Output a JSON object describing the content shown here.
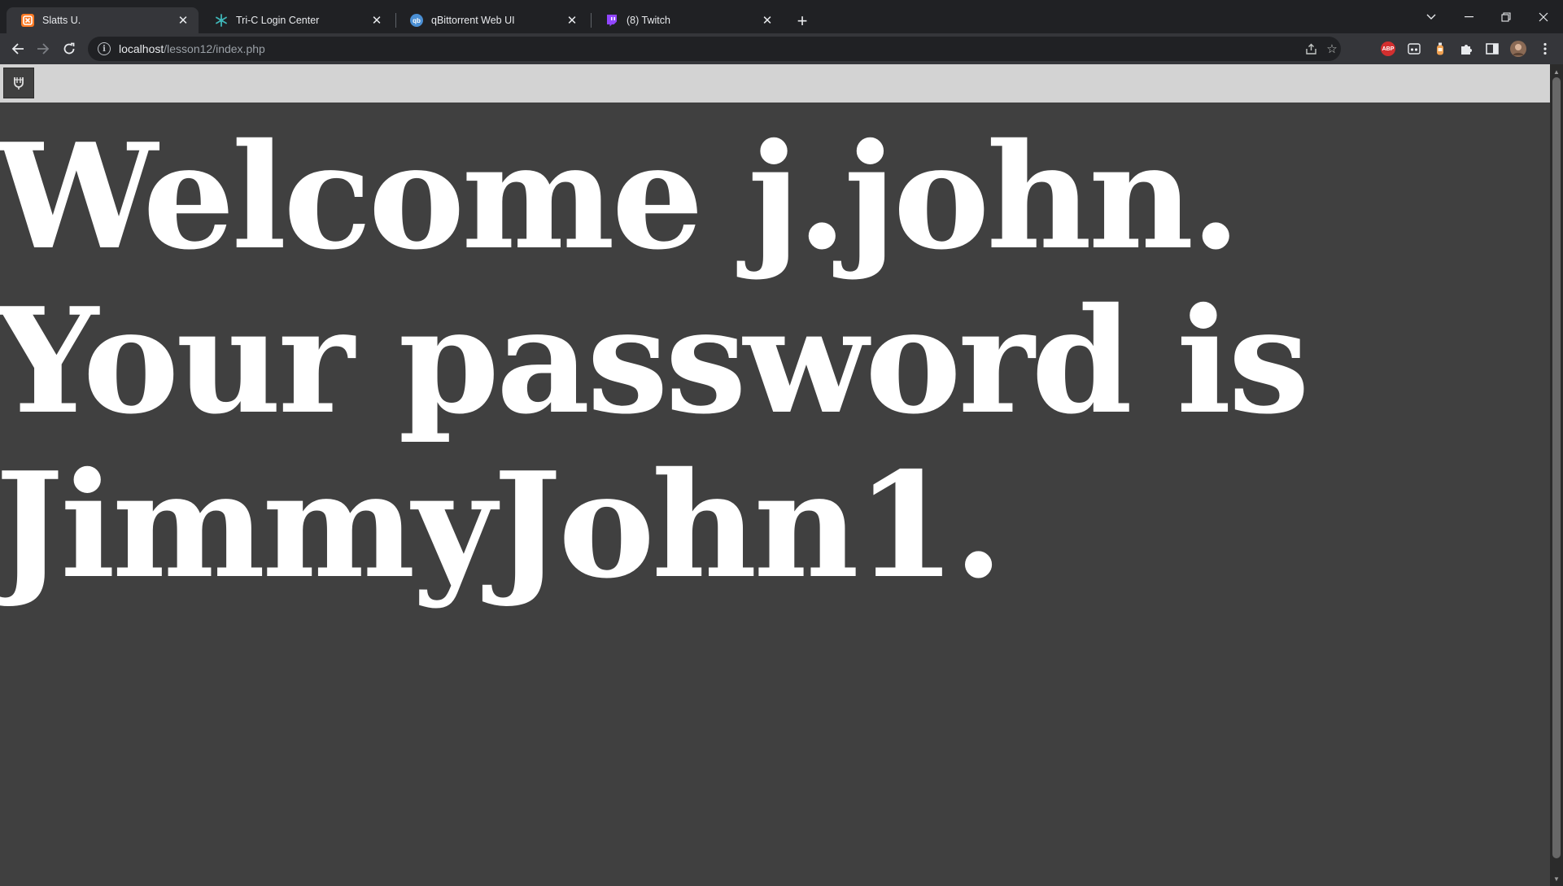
{
  "browser": {
    "tabs": [
      {
        "title": "Slatts U.",
        "favicon": "xampp-icon",
        "favicon_color": "#fb7a24",
        "active": true
      },
      {
        "title": "Tri-C Login Center",
        "favicon": "snowflake-icon",
        "favicon_color": "#3fb6b8",
        "active": false
      },
      {
        "title": "qBittorrent Web UI",
        "favicon": "qbittorrent-icon",
        "favicon_color": "#4a8fd4",
        "active": false
      },
      {
        "title": "(8) Twitch",
        "favicon": "twitch-icon",
        "favicon_color": "#9146ff",
        "active": false
      }
    ],
    "address": {
      "host": "localhost",
      "path": "/lesson12/index.php"
    },
    "extensions": [
      "share-icon",
      "bookmark-star-icon",
      "adblock-plus-icon",
      "reader-icon",
      "bottle-icon",
      "puzzle-icon",
      "side-panel-icon",
      "profile-avatar",
      "menu-kebab-icon"
    ],
    "adblock_label": "ABP"
  },
  "page": {
    "background_color": "#404040",
    "topbar_color": "#d3d3d3",
    "heading": "Welcome j.john. Your password is JimmyJohn1."
  }
}
